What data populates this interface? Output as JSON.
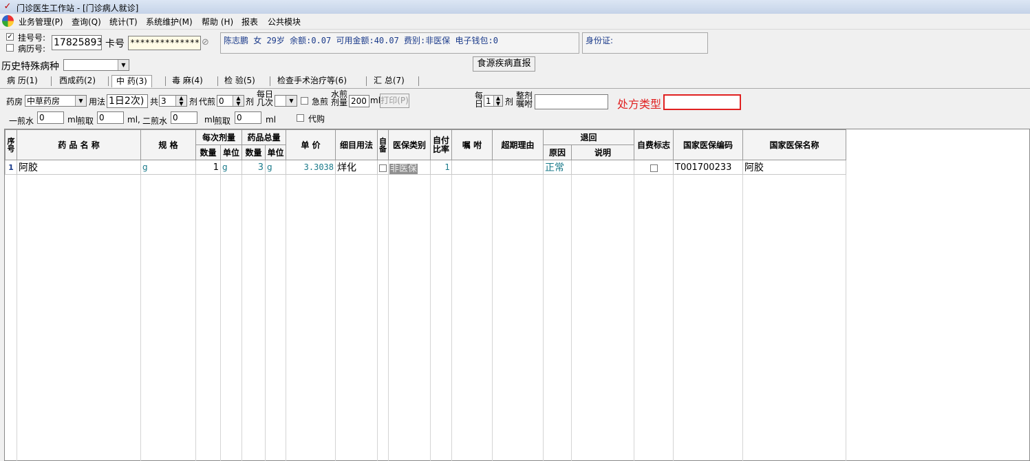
{
  "window": {
    "title": "门诊医生工作站 - [门诊病人就诊]"
  },
  "menu": [
    "业务管理(P)",
    "查询(Q)",
    "统计(T)",
    "系统维护(M)",
    "帮助 (H)",
    "报表",
    "公共模块"
  ],
  "patient": {
    "reg_label": "挂号号:",
    "case_label": "病历号:",
    "reg_no": "17825893",
    "card_label": "卡号",
    "card_no": "**************",
    "info": "陈志鹏 女 29岁 余额:0.07 可用金额:40.07 费别:非医保 电子钱包:0",
    "id_label": "身份证:",
    "id_value": ""
  },
  "history": {
    "label": "历史特殊病种",
    "value": ""
  },
  "report_button": "食源疾病直报",
  "tabs": [
    "病 历(1)",
    "西成药(2)",
    "中 药(3)",
    "毒 麻(4)",
    "检 验(5)",
    "检查手术治疗等(6)",
    "汇 总(7)"
  ],
  "selected_tab": 2,
  "rx": {
    "pharmacy_label": "药房",
    "pharmacy": "中草药房",
    "usage_label": "用法",
    "usage": "1日2次)",
    "total_label": "共",
    "total": "3",
    "dose_unit": "剂",
    "decoct_label": "代煎",
    "decoct": "0",
    "decoct_unit": "剂",
    "daily_label": "每日\n几次",
    "daily": "",
    "urgent_label": "急煎",
    "water_label": "水煎\n剂量",
    "water": "200",
    "water_unit": "ml",
    "print_label": "打印(P)",
    "per_day_label": "每日",
    "per_day": "1",
    "per_day_unit": "剂",
    "note_label": "整剂\n嘱咐",
    "note": "",
    "rx_type_label": "处方类型",
    "rx_type": "",
    "w1_label": "一煎水",
    "w1": "0",
    "w1_unit": "ml",
    "t1_label": "煎取",
    "t1": "0",
    "t1_unit": "ml,",
    "w2_label": "二煎水",
    "w2": "0",
    "w2_unit": "ml",
    "t2_label": "煎取",
    "t2": "0",
    "t2_unit": "ml",
    "proxy_label": "代购"
  },
  "table": {
    "headers": {
      "seq": "序号",
      "name": "药 品 名 称",
      "spec": "规 格",
      "per_dose": "每次剂量",
      "total_qty": "药品总量",
      "qty": "数量",
      "unit": "单位",
      "qty2": "数量",
      "unit2": "单位",
      "price": "单 价",
      "usage": "细目用法",
      "self": "自备",
      "ins_type": "医保类别",
      "self_ratio": "自付比率",
      "note": "嘱 咐",
      "over_reason": "超期理由",
      "refund": "退回",
      "reason": "原因",
      "desc": "说明",
      "self_flag": "自费标志",
      "nat_code": "国家医保编码",
      "nat_name": "国家医保名称"
    },
    "rows": [
      {
        "seq": "1",
        "name": "阿胶",
        "spec": "g",
        "qty": "1",
        "unit": "g",
        "qty2": "3",
        "unit2": "g",
        "price": "3.3038",
        "usage": "烊化",
        "ins_type": "非医保",
        "self_ratio": "1",
        "note": "",
        "over_reason": "",
        "reason": "正常",
        "desc": "",
        "nat_code": "T001700233",
        "nat_name": "阿胶"
      }
    ]
  },
  "colors": {
    "accent_red": "#e02020",
    "teal": "#1a7a8a",
    "blue_text": "#1a3a8a"
  }
}
